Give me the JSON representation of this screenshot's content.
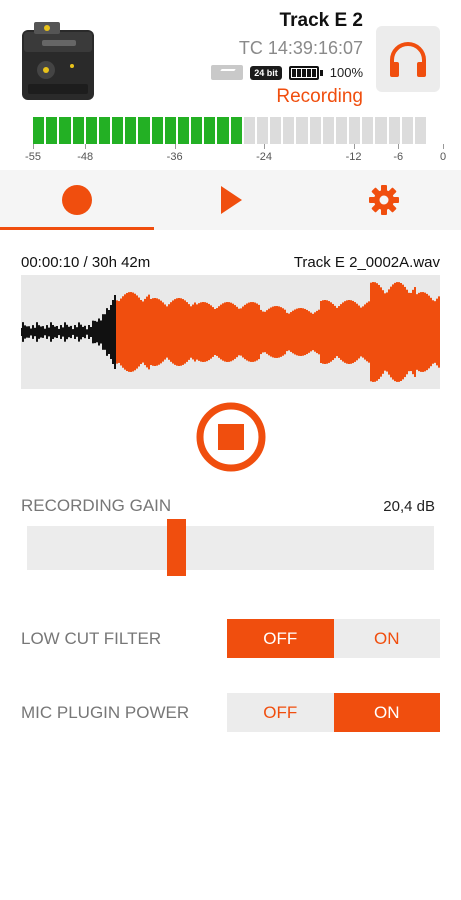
{
  "header": {
    "track_name": "Track E 2",
    "timecode": "TC 14:39:16:07",
    "bit_depth": "24 bit",
    "battery": "100%",
    "status": "Recording",
    "icons": [
      "device-image",
      "sd-card-icon",
      "battery-icon",
      "headphones-icon"
    ]
  },
  "meter": {
    "level_db": -26,
    "scale_labels": [
      "-55",
      "-48",
      "-36",
      "-24",
      "-12",
      "-6",
      "0"
    ],
    "active_color": "#23b024",
    "inactive_color": "#dcdcdc"
  },
  "tabs": [
    {
      "icon": "record-icon",
      "active": true
    },
    {
      "icon": "play-icon",
      "active": false
    },
    {
      "icon": "gear-icon",
      "active": false
    }
  ],
  "recording": {
    "elapsed": "00:00:10 / 30h 42m",
    "filename": "Track E 2_0002A.wav"
  },
  "gain": {
    "label": "RECORDING GAIN",
    "value": "20,4 dB",
    "position": 0.36
  },
  "low_cut": {
    "label": "LOW CUT FILTER",
    "off_label": "OFF",
    "on_label": "ON",
    "selected": "OFF"
  },
  "plugin_power": {
    "label": "MIC PLUGIN POWER",
    "off_label": "OFF",
    "on_label": "ON",
    "selected": "ON"
  },
  "colors": {
    "accent": "#f04e0e",
    "meter_green": "#23b024"
  }
}
